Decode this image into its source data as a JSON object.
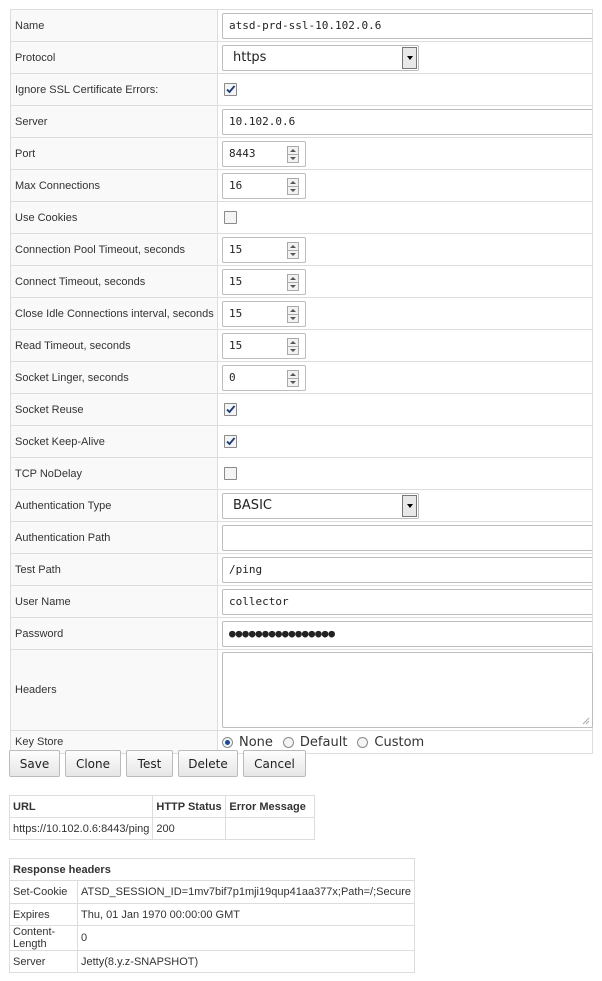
{
  "form": {
    "name": {
      "label": "Name",
      "value": "atsd-prd-ssl-10.102.0.6"
    },
    "protocol": {
      "label": "Protocol",
      "value": "https"
    },
    "ignore_ssl": {
      "label": "Ignore SSL Certificate Errors:",
      "checked": true
    },
    "server": {
      "label": "Server",
      "value": "10.102.0.6"
    },
    "port": {
      "label": "Port",
      "value": "8443"
    },
    "max_connections": {
      "label": "Max Connections",
      "value": "16"
    },
    "use_cookies": {
      "label": "Use Cookies",
      "checked": false
    },
    "pool_timeout": {
      "label": "Connection Pool Timeout, seconds",
      "value": "15"
    },
    "connect_timeout": {
      "label": "Connect Timeout, seconds",
      "value": "15"
    },
    "close_idle": {
      "label": "Close Idle Connections interval, seconds",
      "value": "15"
    },
    "read_timeout": {
      "label": "Read Timeout, seconds",
      "value": "15"
    },
    "socket_linger": {
      "label": "Socket Linger, seconds",
      "value": "0"
    },
    "socket_reuse": {
      "label": "Socket Reuse",
      "checked": true
    },
    "socket_keepalive": {
      "label": "Socket Keep-Alive",
      "checked": true
    },
    "tcp_nodelay": {
      "label": "TCP NoDelay",
      "checked": false
    },
    "auth_type": {
      "label": "Authentication Type",
      "value": "BASIC"
    },
    "auth_path": {
      "label": "Authentication Path",
      "value": ""
    },
    "test_path": {
      "label": "Test Path",
      "value": "/ping"
    },
    "user_name": {
      "label": "User Name",
      "value": "collector"
    },
    "password": {
      "label": "Password",
      "value": "●●●●●●●●●●●●●●●●"
    },
    "headers": {
      "label": "Headers",
      "value": ""
    },
    "key_store": {
      "label": "Key Store",
      "options": [
        "None",
        "Default",
        "Custom"
      ],
      "selected": "None"
    }
  },
  "buttons": {
    "save": "Save",
    "clone": "Clone",
    "test": "Test",
    "delete": "Delete",
    "cancel": "Cancel"
  },
  "result": {
    "headers": [
      "URL",
      "HTTP Status",
      "Error Message"
    ],
    "row": {
      "url": "https://10.102.0.6:8443/ping",
      "status": "200",
      "error": ""
    }
  },
  "response_headers": {
    "title": "Response headers",
    "rows": [
      {
        "name": "Set-Cookie",
        "value": "ATSD_SESSION_ID=1mv7bif7p1mji19qup41aa377x;Path=/;Secure"
      },
      {
        "name": "Expires",
        "value": "Thu, 01 Jan 1970 00:00:00 GMT"
      },
      {
        "name": "Content-Length",
        "value": "0"
      },
      {
        "name": "Server",
        "value": "Jetty(8.y.z-SNAPSHOT)"
      }
    ]
  }
}
